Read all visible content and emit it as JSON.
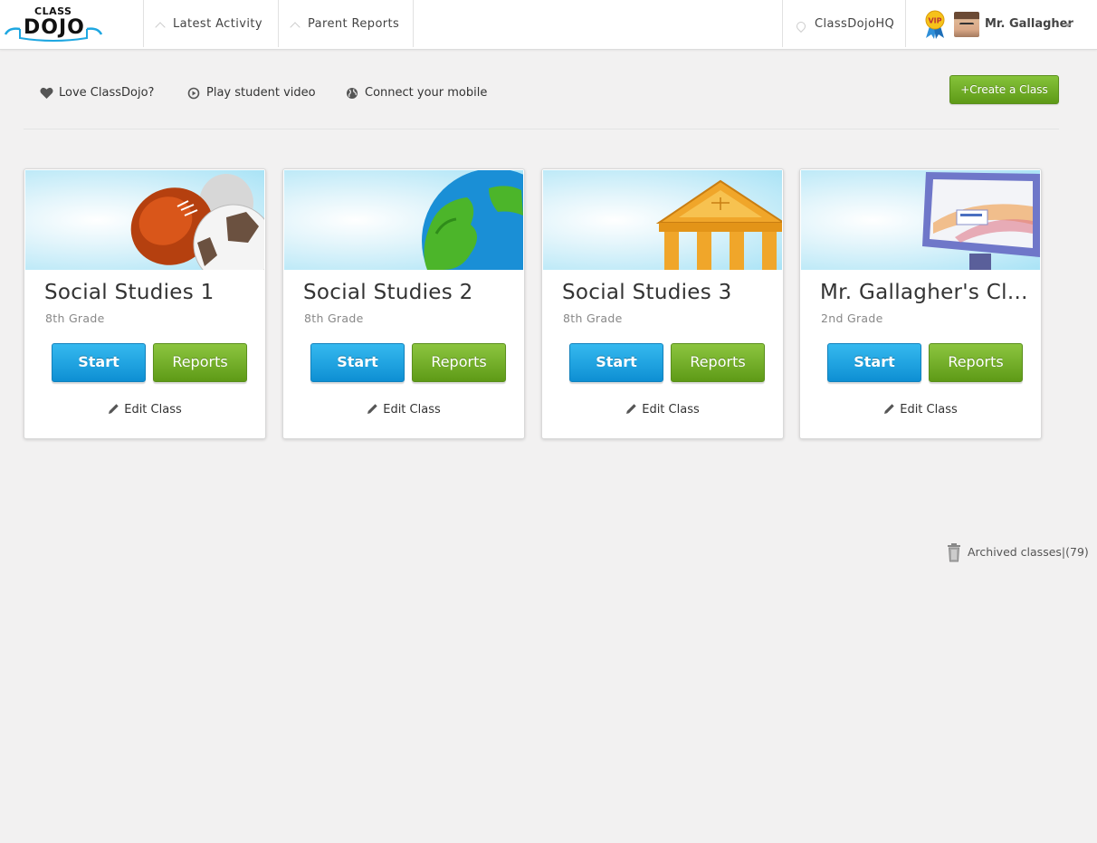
{
  "brand": {
    "logo_top": "CLASS",
    "logo_main": "DOJO",
    "accent_blue": "#1ea7e1",
    "accent_green": "#6fae26"
  },
  "nav": {
    "latest_activity": "Latest Activity",
    "parent_reports": "Parent Reports",
    "classdojo_hq": "ClassDojoHQ",
    "user_name": "Mr. Gallagher",
    "vip_label": "VIP"
  },
  "toolbar": {
    "love": "Love ClassDojo?",
    "play_video": "Play student video",
    "connect_mobile": "Connect your mobile",
    "create_class": "+Create a Class"
  },
  "classes": [
    {
      "title": "Social Studies 1",
      "grade": "8th Grade",
      "start": "Start",
      "reports": "Reports",
      "edit": "Edit Class",
      "banner": "sports-balls"
    },
    {
      "title": "Social Studies 2",
      "grade": "8th Grade",
      "start": "Start",
      "reports": "Reports",
      "edit": "Edit Class",
      "banner": "globe"
    },
    {
      "title": "Social Studies 3",
      "grade": "8th Grade",
      "start": "Start",
      "reports": "Reports",
      "edit": "Edit Class",
      "banner": "courthouse"
    },
    {
      "title": "Mr. Gallagher's Cl...",
      "grade": "2nd Grade",
      "start": "Start",
      "reports": "Reports",
      "edit": "Edit Class",
      "banner": "computer-monitor"
    }
  ],
  "archived": {
    "label": "Archived classes|(79)"
  }
}
